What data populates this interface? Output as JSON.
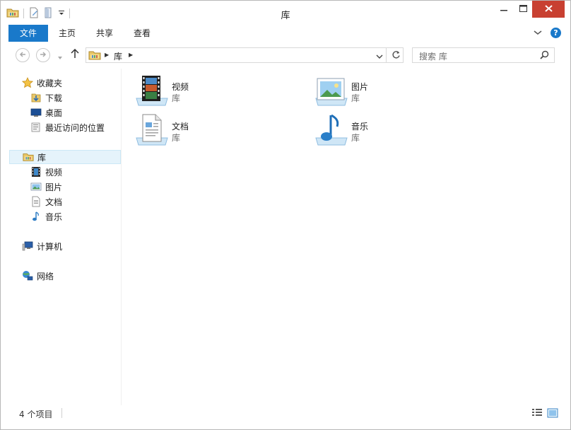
{
  "window": {
    "title": "库"
  },
  "ribbon": {
    "tabs": [
      {
        "label": "文件"
      },
      {
        "label": "主页"
      },
      {
        "label": "共享"
      },
      {
        "label": "查看"
      }
    ],
    "help_label": "?"
  },
  "address": {
    "breadcrumb": "库",
    "search_placeholder": "搜索 库"
  },
  "nav": {
    "favorites": {
      "label": "收藏夹",
      "items": [
        "下载",
        "桌面",
        "最近访问的位置"
      ]
    },
    "libraries": {
      "label": "库",
      "items": [
        "视频",
        "图片",
        "文档",
        "音乐"
      ]
    },
    "computer": "计算机",
    "network": "网络"
  },
  "content": {
    "tiles": [
      {
        "name": "视频",
        "sub": "库",
        "icon": "video-library-icon"
      },
      {
        "name": "图片",
        "sub": "库",
        "icon": "pictures-library-icon"
      },
      {
        "name": "文档",
        "sub": "库",
        "icon": "documents-library-icon"
      },
      {
        "name": "音乐",
        "sub": "库",
        "icon": "music-library-icon"
      }
    ]
  },
  "status": {
    "text": "4 个项目"
  },
  "colors": {
    "accent": "#1979ca",
    "close": "#c84031",
    "selection": "#e5f3fb"
  }
}
